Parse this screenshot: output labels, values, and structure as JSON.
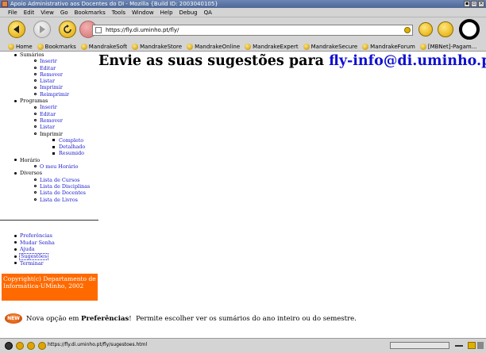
{
  "window": {
    "title": "Apoio Administrativo aos Docentes do DI - Mozilla {Build ID: 2003040105}"
  },
  "menubar": [
    "File",
    "Edit",
    "View",
    "Go",
    "Bookmarks",
    "Tools",
    "Window",
    "Help",
    "Debug",
    "QA"
  ],
  "navigation": {
    "url": "https://fly.di.uminho.pt/fly/"
  },
  "bookmarks": [
    "Home",
    "Bookmarks",
    "MandrakeSoft",
    "MandrakeStore",
    "MandrakeOnline",
    "MandrakeExpert",
    "MandrakeSecure",
    "MandrakeForum",
    "[MBNet]-Pagam..."
  ],
  "page": {
    "heading_prefix": "Envie as suas sugestões para",
    "heading_email": "fly-info@di.uminho.pt"
  },
  "sidebar": {
    "sumarios": {
      "label": "Sumários",
      "items": [
        "Inserir",
        "Editar",
        "Remover",
        "Listar",
        "Imprimir",
        "Reimprimir"
      ]
    },
    "programas": {
      "label": "Programas",
      "items": [
        "Inserir",
        "Editar",
        "Remover",
        "Listar"
      ],
      "imprimir": {
        "label": "Imprimir",
        "items": [
          "Completo",
          "Detalhado",
          "Resumido"
        ]
      }
    },
    "horario": {
      "label": "Horário",
      "items": [
        "O meu Horário"
      ]
    },
    "diversos": {
      "label": "Diversos",
      "items": [
        "Lista de Cursos",
        "Lista de Disciplinas",
        "Lista de Docentes",
        "Lista de Livros"
      ]
    },
    "bottom": [
      "Preferências",
      "Mudar Senha",
      "Ajuda",
      "Sugestões",
      "Terminar"
    ],
    "copyright": "Copyright(c) Departamento de Informática-UMinho, 2002"
  },
  "news": {
    "badge": "NEW",
    "prefix": "Nova opção em",
    "bold": "Preferências",
    "suffix": "!  Permite escolher ver os sumários do ano inteiro ou do semestre."
  },
  "statusbar": {
    "text": "https://fly.di.uminho.pt/fly/sugestoes.html",
    "progress": 0.0
  },
  "colors": {
    "accent_orange": "#ff6a00",
    "link_blue": "#1a1acc",
    "title_blue": "#4d6796"
  }
}
